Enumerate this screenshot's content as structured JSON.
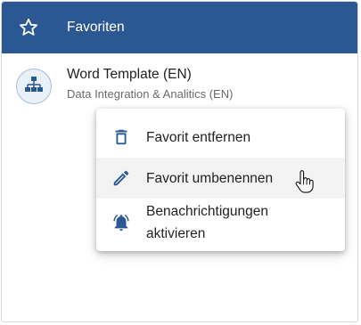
{
  "header": {
    "title": "Favoriten",
    "icon": "star-outline-icon",
    "background": "#2b5793"
  },
  "favorite": {
    "title": "Word Template (EN)",
    "subtitle": "Data Integration & Analitics (EN)",
    "icon": "sitemap-icon"
  },
  "context_menu": {
    "items": [
      {
        "label": "Favorit entfernen",
        "icon": "trash-icon"
      },
      {
        "label": "Favorit umbenennen",
        "icon": "pencil-icon",
        "hovered": true
      },
      {
        "label_line1": "Benachrichtigungen",
        "label_line2": "aktivieren",
        "icon": "bell-ring-icon"
      }
    ]
  },
  "accent_color": "#2b5793"
}
